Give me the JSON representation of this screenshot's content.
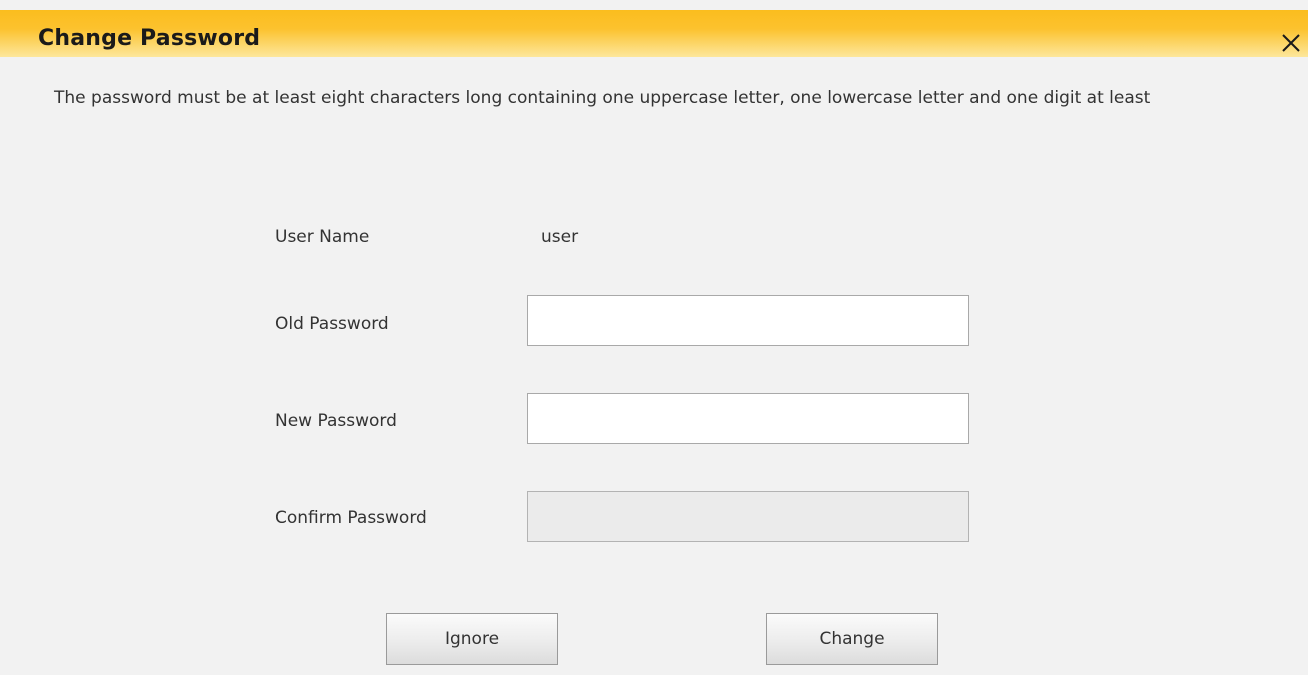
{
  "dialog": {
    "title": "Change Password",
    "close_icon": "close-icon",
    "instructions": "The password must be at least eight characters long containing one uppercase letter, one lowercase letter and one digit at least"
  },
  "form": {
    "user_name_label": "User Name",
    "user_name_value": "user",
    "old_password_label": "Old Password",
    "old_password_value": "",
    "new_password_label": "New Password",
    "new_password_value": "",
    "confirm_password_label": "Confirm Password",
    "confirm_password_value": "",
    "confirm_password_disabled": true
  },
  "buttons": {
    "ignore_label": "Ignore",
    "change_label": "Change"
  },
  "colors": {
    "title_bar": "#fbbd1e",
    "background": "#f2f2f2"
  }
}
